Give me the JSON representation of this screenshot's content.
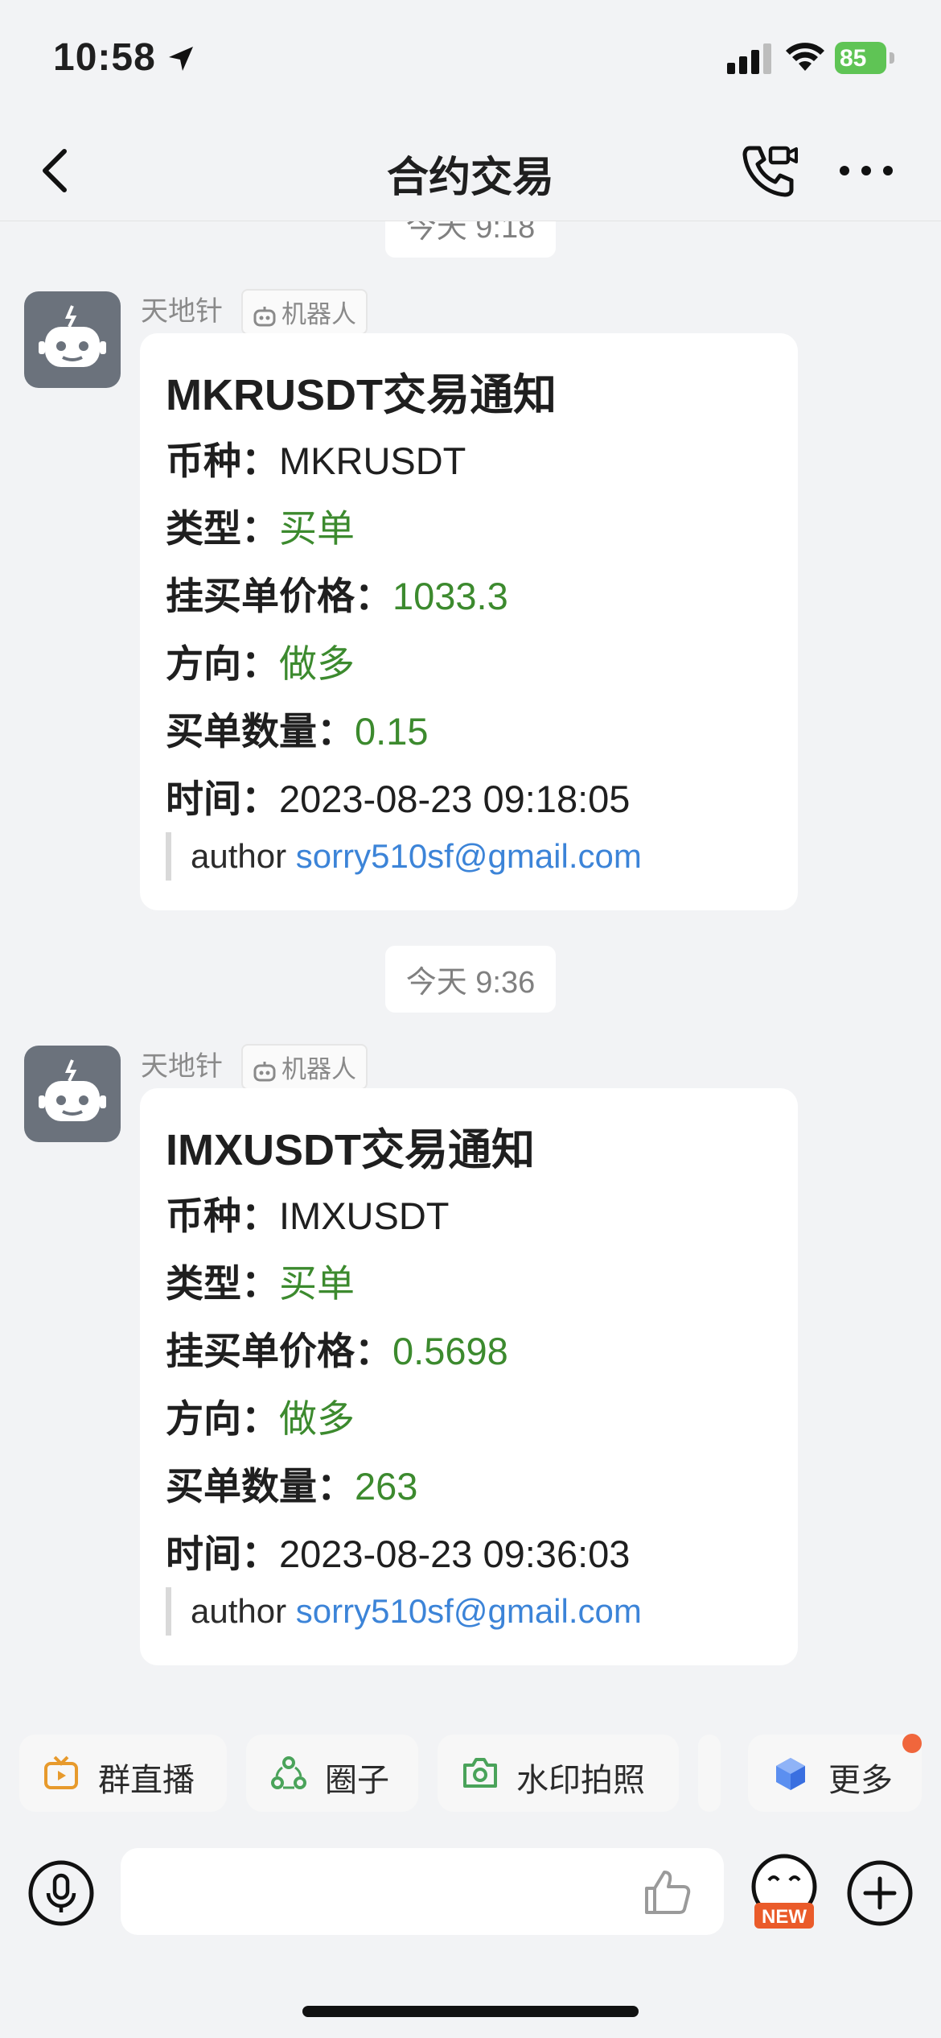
{
  "status_bar": {
    "time": "10:58",
    "battery": "85"
  },
  "header": {
    "title": "合约交易"
  },
  "chat": {
    "partial_timestamp": "今天 9:18",
    "messages": [
      {
        "timestamp": "",
        "sender": "天地针",
        "tag": "机器人",
        "title": "MKRUSDT交易通知",
        "fields": [
          {
            "key": "币种：",
            "value": "MKRUSDT",
            "color": "#1f1f1f"
          },
          {
            "key": "类型：",
            "value": "买单",
            "color": "#3c8a2e"
          },
          {
            "key": "挂买单价格：",
            "value": "1033.3",
            "color": "#3c8a2e"
          },
          {
            "key": "方向：",
            "value": "做多",
            "color": "#3c8a2e"
          },
          {
            "key": "买单数量：",
            "value": "0.15",
            "color": "#3c8a2e"
          },
          {
            "key": "时间：",
            "value": "2023-08-23 09:18:05",
            "color": "#1f1f1f"
          }
        ],
        "author_label": "author",
        "author_email": "sorry510sf@gmail.com"
      },
      {
        "timestamp": "今天 9:36",
        "sender": "天地针",
        "tag": "机器人",
        "title": "IMXUSDT交易通知",
        "fields": [
          {
            "key": "币种：",
            "value": "IMXUSDT",
            "color": "#1f1f1f"
          },
          {
            "key": "类型：",
            "value": "买单",
            "color": "#3c8a2e"
          },
          {
            "key": "挂买单价格：",
            "value": "0.5698",
            "color": "#3c8a2e"
          },
          {
            "key": "方向：",
            "value": "做多",
            "color": "#3c8a2e"
          },
          {
            "key": "买单数量：",
            "value": "263",
            "color": "#3c8a2e"
          },
          {
            "key": "时间：",
            "value": "2023-08-23 09:36:03",
            "color": "#1f1f1f"
          }
        ],
        "author_label": "author",
        "author_email": "sorry510sf@gmail.com"
      }
    ]
  },
  "quick_actions": [
    {
      "label": "群直播",
      "icon": "tv-icon"
    },
    {
      "label": "圈子",
      "icon": "circle-group-icon"
    },
    {
      "label": "水印拍照",
      "icon": "camera-icon"
    },
    {
      "label": "更多",
      "icon": "cube-icon"
    }
  ],
  "input_bar": {
    "emoji_badge": "NEW"
  },
  "colors": {
    "accent_green": "#3c8a2e",
    "link_blue": "#3c84d8",
    "notification_dot": "#f0663c"
  }
}
